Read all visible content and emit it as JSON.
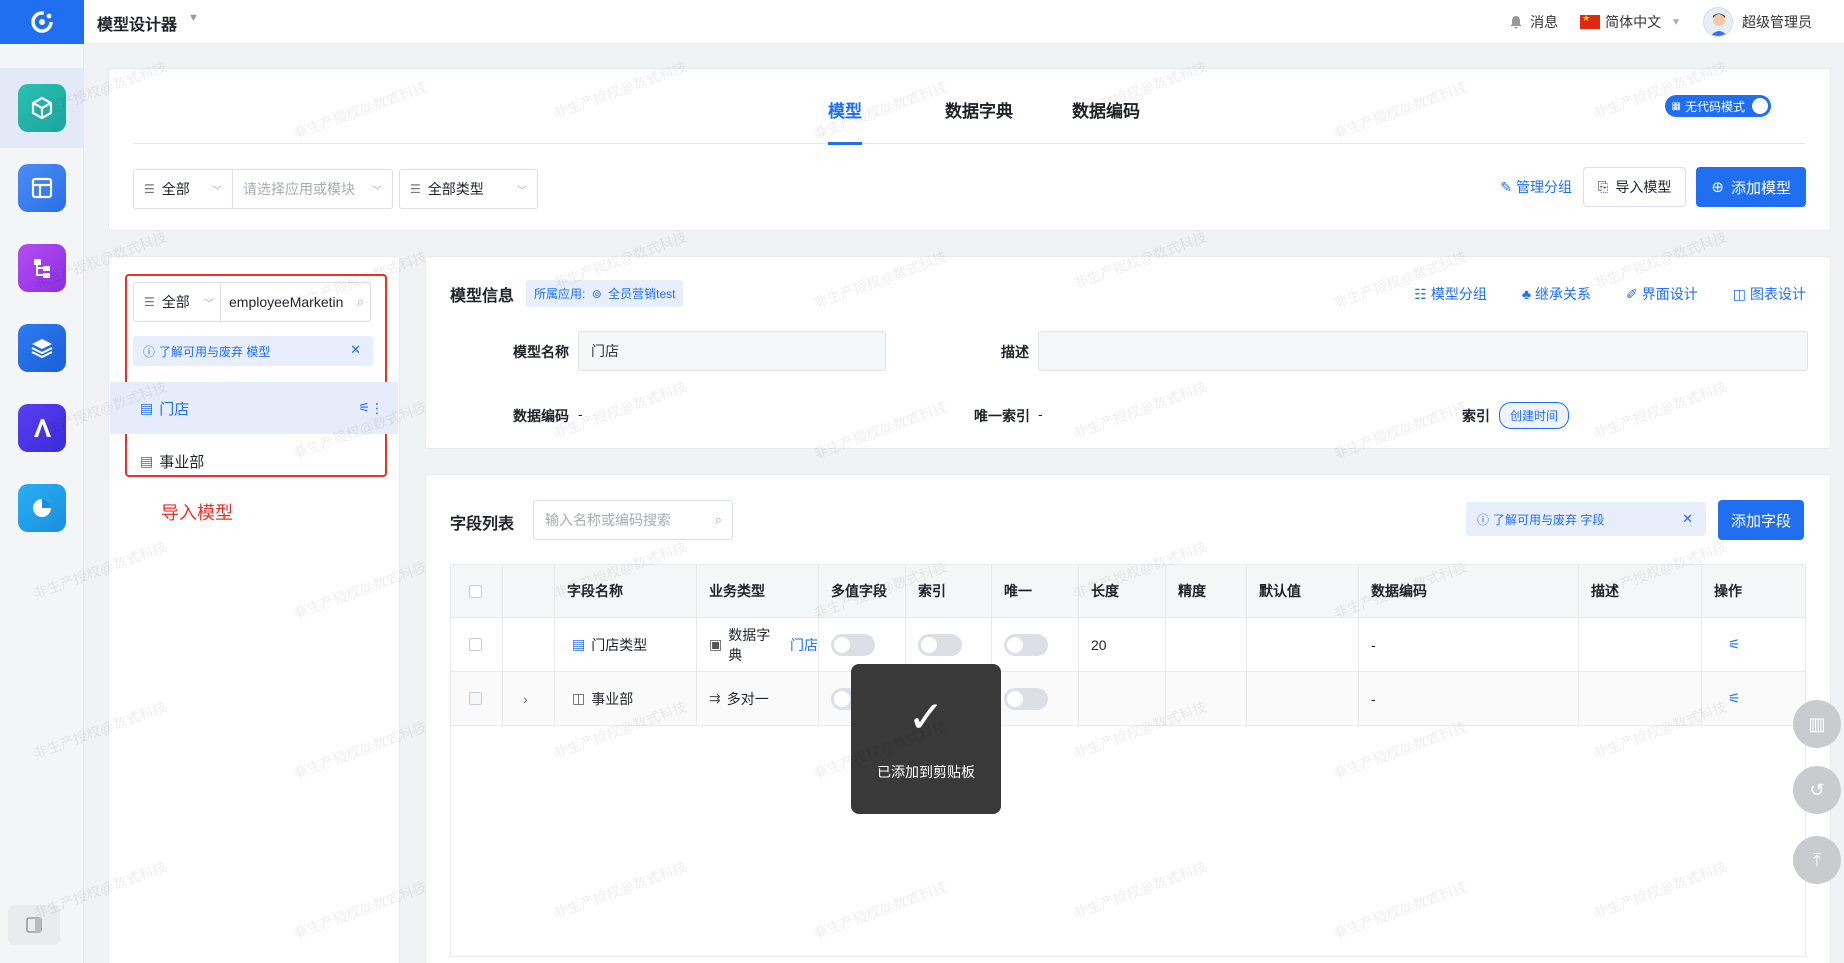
{
  "app": {
    "title": "模型设计器"
  },
  "topbar": {
    "messages_label": "消息",
    "language": "简体中文",
    "user": "超级管理员"
  },
  "rail": {
    "items": [
      "model-designer",
      "page-designer",
      "flow-designer",
      "data-layer",
      "ai-designer",
      "report-designer"
    ]
  },
  "tabs": [
    {
      "label": "模型"
    },
    {
      "label": "数据字典"
    },
    {
      "label": "数据编码"
    }
  ],
  "nocode_toggle": {
    "label": "无代码模式",
    "on": true
  },
  "filters": {
    "scope": "全部",
    "module_placeholder": "请选择应用或模块",
    "type": "全部类型"
  },
  "actions": {
    "manage_groups": "管理分组",
    "import_model": "导入模型",
    "add_model": "添加模型"
  },
  "left_panel": {
    "scope": "全部",
    "search_value": "employeeMarketin",
    "hint": "了解可用与废弃 模型",
    "items": [
      {
        "label": "门店",
        "selected": true
      },
      {
        "label": "事业部",
        "selected": false
      }
    ],
    "annotation": "导入模型"
  },
  "model_info": {
    "title": "模型信息",
    "app_badge_prefix": "所属应用:",
    "app_badge_value": "全员营销test",
    "links": {
      "group": "模型分组",
      "inherit": "继承关系",
      "ui_design": "界面设计",
      "chart_design": "图表设计"
    },
    "name_label": "模型名称",
    "name_value": "门店",
    "desc_label": "描述",
    "desc_value": "",
    "code_label": "数据编码",
    "code_value": "-",
    "unique_label": "唯一索引",
    "unique_value": "-",
    "index_label": "索引",
    "index_tag": "创建时间"
  },
  "fields": {
    "title": "字段列表",
    "search_placeholder": "输入名称或编码搜索",
    "hint": "了解可用与废弃 字段",
    "add_button": "添加字段",
    "columns": [
      "字段名称",
      "业务类型",
      "多值字段",
      "索引",
      "唯一",
      "长度",
      "精度",
      "默认值",
      "数据编码",
      "描述",
      "操作"
    ],
    "rows": [
      {
        "name": "门店类型",
        "biz_type": "数据字典",
        "biz_link": "门店",
        "multi": false,
        "index": false,
        "unique": false,
        "length": "20",
        "precision": "",
        "default": "",
        "code": "-",
        "desc": ""
      },
      {
        "name": "事业部",
        "biz_type": "多对一",
        "biz_link": "",
        "multi": false,
        "index": false,
        "unique": false,
        "length": "",
        "precision": "",
        "default": "",
        "code": "-",
        "desc": ""
      }
    ]
  },
  "toast": {
    "message": "已添加到剪贴板"
  },
  "watermark": "非生产授权@数式科技",
  "colors": {
    "primary": "#1f6ff0",
    "annotation_red": "#e8332a",
    "toast_bg": "#393939"
  }
}
